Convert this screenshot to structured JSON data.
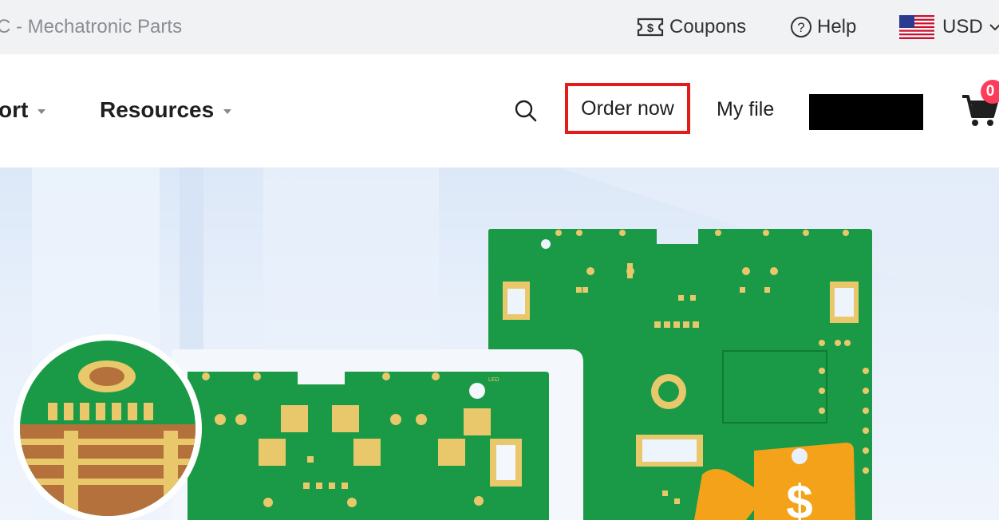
{
  "topbar": {
    "brand_tail": "C - Mechatronic Parts",
    "coupons_label": "Coupons",
    "help_label": "Help",
    "currency_label": "USD",
    "icons": [
      "coupon-icon",
      "help-icon",
      "us-flag-icon",
      "chevron-down-icon"
    ]
  },
  "nav": {
    "support_label": "ort",
    "resources_label": "Resources",
    "order_now_label": "Order now",
    "my_file_label": "My file",
    "cart_count": "0",
    "icons": [
      "search-icon",
      "cart-icon"
    ],
    "highlight_color": "#e21b1b",
    "badge_color": "#ff3b5c"
  },
  "hero": {
    "board_color": "#1a9a47",
    "pad_color": "#e8c86a",
    "coin_color": "#f5a21b",
    "label": "LED"
  }
}
